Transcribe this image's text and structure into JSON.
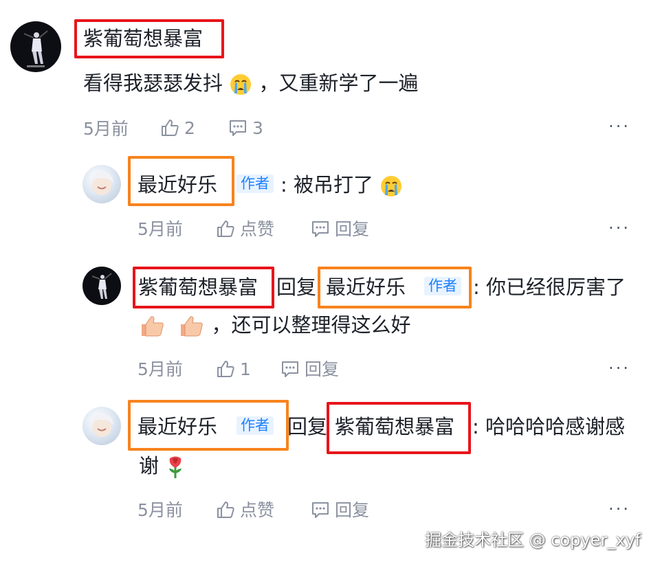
{
  "colors": {
    "highlight_red": "#e8141b",
    "highlight_orange": "#f7831d",
    "author_tag_bg": "#e8f3ff",
    "author_tag_text": "#1e80ff",
    "meta_text": "#8a919f"
  },
  "author_tag": "作者",
  "reply_word": "回复",
  "more_label": "···",
  "comment": {
    "user": "紫葡萄想暴富",
    "text": "看得我瑟瑟发抖",
    "text_suffix": "，又重新学了一遍",
    "emoji": "crying-face",
    "time": "5月前",
    "likes": "2",
    "replies": "3"
  },
  "replies": [
    {
      "user": "最近好乐",
      "is_author": true,
      "text": ": 被吊打了",
      "emoji": "crying-face",
      "time": "5月前",
      "like_label": "点赞",
      "reply_label": "回复"
    },
    {
      "user": "紫葡萄想暴富",
      "reply_to": "最近好乐",
      "reply_to_is_author": true,
      "text_line1": ": 你已经很厉害了",
      "text_line2": "，还可以整理得这么好",
      "emoji": [
        "thumbs-up",
        "thumbs-up"
      ],
      "time": "5月前",
      "likes": "1",
      "reply_label": "回复"
    },
    {
      "user": "最近好乐",
      "is_author": true,
      "reply_to": "紫葡萄想暴富",
      "text_line1": ": 哈哈哈哈感谢感",
      "text_line2": "谢",
      "emoji": "rose",
      "time": "5月前",
      "like_label": "点赞",
      "reply_label": "回复"
    }
  ],
  "watermark": "掘金技术社区 @ copyer_xyf"
}
